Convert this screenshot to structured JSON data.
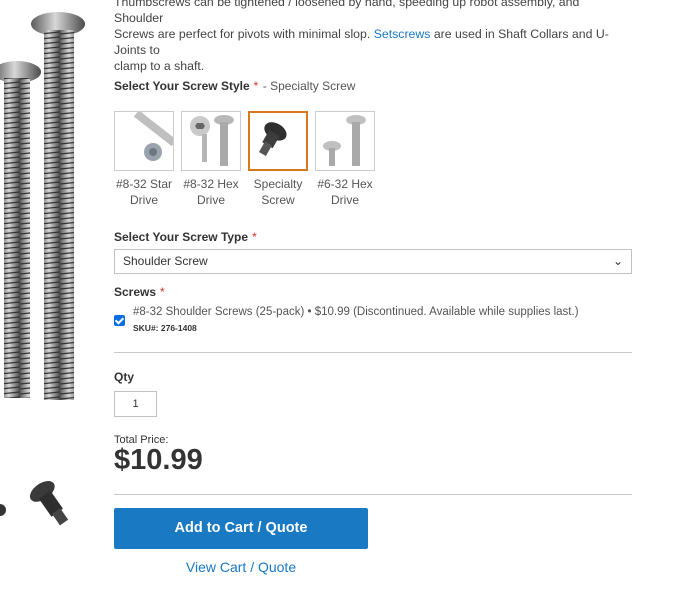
{
  "description": {
    "line1": "Thumbscrews can be tightened / loosened by hand, speeding up robot assembly, and Shoulder",
    "line2": "Screws are perfect for pivots with minimal slop.",
    "link": "Setscrews",
    "line2b": "are used in Shaft Collars and U-Joints to",
    "line3": "clamp to a shaft."
  },
  "style_selector": {
    "label": "Select Your Screw Style",
    "required_mark": "*",
    "selected_value": "- Specialty Screw",
    "options": [
      {
        "line1": "#8-32 Star",
        "line2": "Drive",
        "icon": "star-drive-screw-image",
        "selected": false
      },
      {
        "line1": "#8-32 Hex",
        "line2": "Drive",
        "icon": "hex-drive-screw-image",
        "selected": false
      },
      {
        "line1": "Specialty",
        "line2": "Screw",
        "icon": "specialty-screw-image",
        "selected": true
      },
      {
        "line1": "#6-32 Hex",
        "line2": "Drive",
        "icon": "hex-drive-screw-image",
        "selected": false
      }
    ]
  },
  "type_selector": {
    "label": "Select Your Screw Type",
    "required_mark": "*",
    "selected_value": "Shoulder Screw"
  },
  "screws": {
    "label": "Screws",
    "required_mark": "*",
    "option_text": "#8-32 Shoulder Screws (25-pack) • $10.99 (Discontinued. Available while supplies last.)",
    "sku": "SKU#: 276-1408",
    "checked": true
  },
  "qty": {
    "label": "Qty",
    "value": "1"
  },
  "total": {
    "label": "Total Price:",
    "price": "$10.99"
  },
  "actions": {
    "add_to_cart": "Add to Cart / Quote",
    "view_cart": "View Cart / Quote"
  },
  "colors": {
    "accent": "#1979c3",
    "required": "#e02b27",
    "selected_border": "#d97a1a"
  }
}
